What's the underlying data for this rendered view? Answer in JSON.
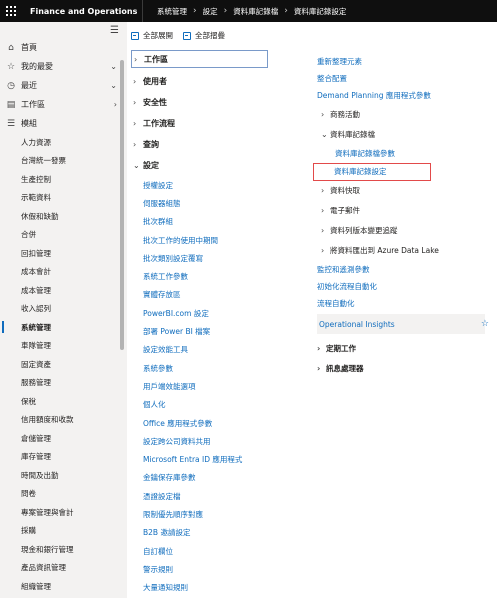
{
  "header": {
    "app_title": "Finance and Operations",
    "breadcrumb": [
      "系統管理",
      "設定",
      "資料庫記錄檔",
      "資料庫記錄設定"
    ]
  },
  "leftnav": {
    "top_items": [
      {
        "label": "首頁",
        "icon": "home-icon",
        "glyph": "⌂"
      },
      {
        "label": "我的最愛",
        "icon": "star-icon",
        "glyph": "☆"
      },
      {
        "label": "最近",
        "icon": "clock-icon",
        "glyph": "◷"
      },
      {
        "label": "工作區",
        "icon": "workspace-icon",
        "glyph": "▤"
      },
      {
        "label": "模組",
        "icon": "list-icon",
        "glyph": "☰"
      }
    ],
    "modules": [
      "人力資源",
      "台灣統一發票",
      "生產控制",
      "示範資料",
      "休假和缺勤",
      "合併",
      "回扣管理",
      "成本會計",
      "成本管理",
      "收入認列",
      "系統管理",
      "車隊管理",
      "固定資產",
      "服務管理",
      "保稅",
      "信用額度和收款",
      "倉儲管理",
      "庫存管理",
      "時間及出勤",
      "問卷",
      "專案管理與會計",
      "採購",
      "現金和銀行管理",
      "產品資訊管理",
      "組織管理"
    ],
    "selected": "系統管理"
  },
  "toolbar": {
    "expand_all": "全部展開",
    "collapse_all": "全部摺疊"
  },
  "left_column": {
    "groups_collapsed": [
      "工作區",
      "使用者",
      "安全性",
      "工作流程",
      "查詢"
    ],
    "setup_group": "設定",
    "setup_links": [
      "授權設定",
      "伺服器組態",
      "批次群組",
      "批次工作的使用中期間",
      "批次類別設定覆寫",
      "系統工作參數",
      "實體存放區",
      "PowerBI.com 設定",
      "部署 Power BI 檔案",
      "設定效能工具",
      "系統參數",
      "用戶端效能選項",
      "個人化",
      "Office 應用程式參數",
      "設定跨公司資料共用",
      "Microsoft Entra ID 應用程式",
      "金鑰保存庫參數",
      "憑證設定檔",
      "限制優先順序對應",
      "B2B 邀請設定",
      "自訂欄位",
      "警示規則",
      "大量通知規則"
    ]
  },
  "right_column": {
    "links_top": [
      "重新整理元素",
      "整合配置",
      "Demand Planning 應用程式參數"
    ],
    "business_events": "商務活動",
    "db_log": "資料庫記錄檔",
    "db_log_children": [
      "資料庫記錄檔參數",
      "資料庫記錄設定"
    ],
    "collapsed_groups": [
      "資料快取",
      "電子郵件",
      "資料列版本變更追蹤",
      "將資料匯出到 Azure Data Lake"
    ],
    "links_bottom": [
      "監控和遙測參數",
      "初始化流程自動化",
      "流程自動化"
    ],
    "operational_insights": "Operational Insights",
    "bold_groups": [
      "定期工作",
      "訊息處理器"
    ]
  },
  "colors": {
    "accent": "#0f6cbd",
    "topbar": "#0f0f0f",
    "highlight_box": "#e24a4a"
  }
}
